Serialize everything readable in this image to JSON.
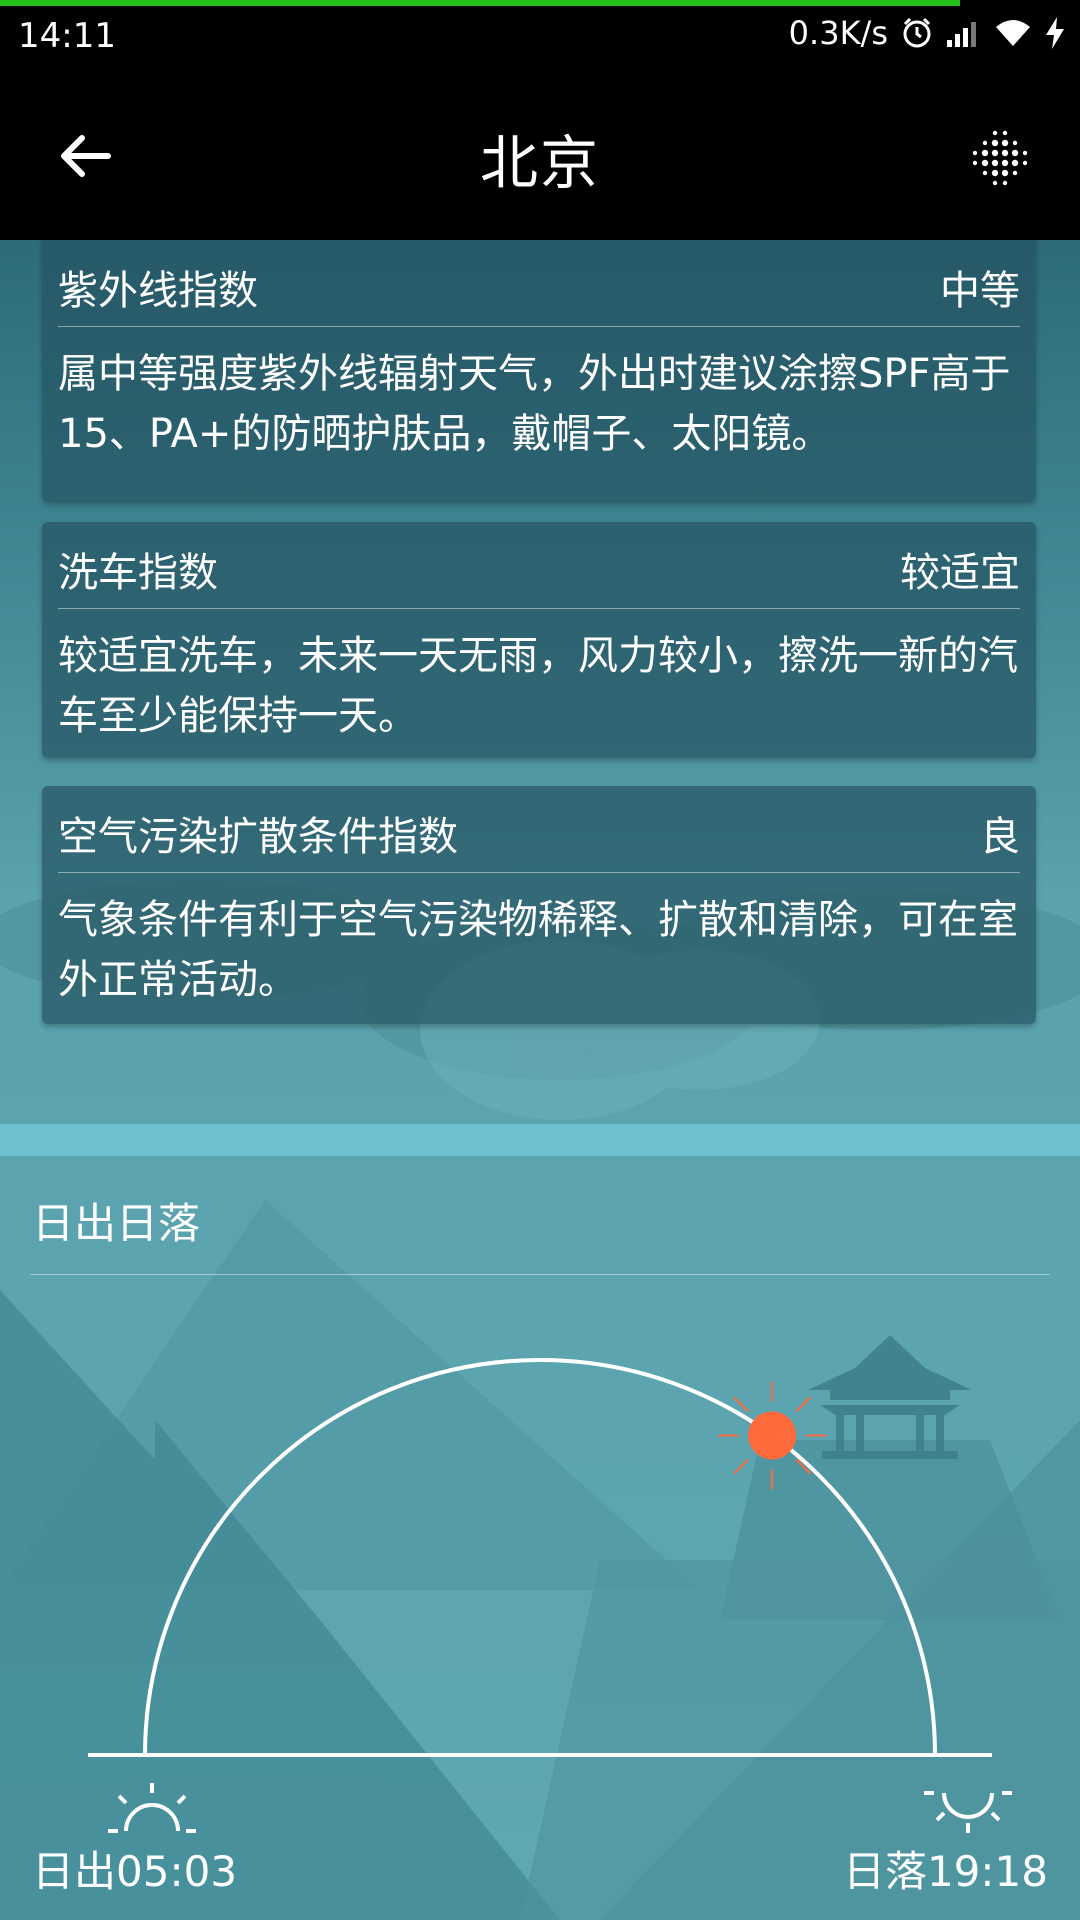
{
  "status_bar": {
    "time": "14:11",
    "network_speed": "0.3K/s",
    "icons": [
      "alarm-icon",
      "signal-icon",
      "wifi-icon",
      "charging-icon"
    ]
  },
  "toolbar": {
    "title": "北京",
    "back_icon": "back-arrow-icon",
    "menu_icon": "dot-grid-icon"
  },
  "indices": [
    {
      "title": "紫外线指数",
      "level": "中等",
      "description": "属中等强度紫外线辐射天气，外出时建议涂擦SPF高于15、PA+的防晒护肤品，戴帽子、太阳镜。"
    },
    {
      "title": "洗车指数",
      "level": "较适宜",
      "description": "较适宜洗车，未来一天无雨，风力较小，擦洗一新的汽车至少能保持一天。"
    },
    {
      "title": "空气污染扩散条件指数",
      "level": "良",
      "description": "气象条件有利于空气污染物稀释、扩散和清除，可在室外正常活动。"
    }
  ],
  "sun": {
    "section_title": "日出日落",
    "sunrise": "日出05:03",
    "sunset": "日落19:18",
    "sun_color": "#ff6a3d",
    "sun_position_fraction": 0.7
  }
}
